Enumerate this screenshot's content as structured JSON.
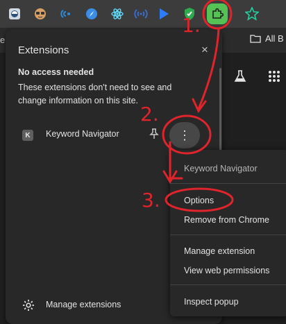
{
  "toolbar": {
    "icons": [
      "browser-app-icon",
      "face-avatar-icon",
      "wifi-signal-icon",
      "compass-icon",
      "atom-icon",
      "broadcast-icon",
      "play-arrow-icon",
      "shield-check-icon",
      "puzzle-extensions-icon",
      "star-sparkle-icon"
    ]
  },
  "bookmarks_bar": {
    "left_fragment": "e.",
    "folder_label": "All B"
  },
  "extensions_popup": {
    "title": "Extensions",
    "close_glyph": "×",
    "section_title": "No access needed",
    "section_description": "These extensions don't need to see and change information on this site.",
    "extension": {
      "icon_letter": "K",
      "name": "Keyword Navigator",
      "more_glyph": "⋮"
    },
    "manage_label": "Manage extensions"
  },
  "context_menu": {
    "header": "Keyword Navigator",
    "items": [
      {
        "label": "Options"
      },
      {
        "label": "Remove from Chrome"
      },
      {
        "label": "Manage extension"
      },
      {
        "label": "View web permissions"
      },
      {
        "label": "Inspect popup"
      }
    ]
  },
  "annotations": {
    "numbers": [
      "1.",
      "2.",
      "3."
    ],
    "color": "#e0242b"
  },
  "colors": {
    "toolbar_bg": "#3c3c3c",
    "popup_bg": "#282828",
    "accent_red": "#e0242b",
    "puzzle_highlight": "#55c255"
  }
}
